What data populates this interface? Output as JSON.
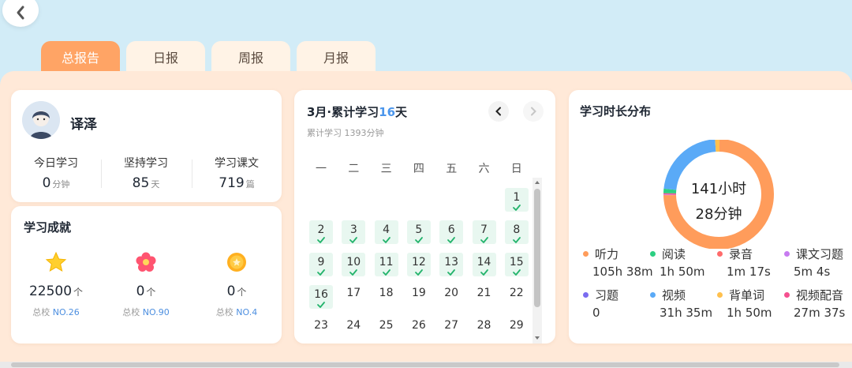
{
  "tabs": [
    "总报告",
    "日报",
    "周报",
    "月报"
  ],
  "profile": {
    "name": "译泽",
    "stats": [
      {
        "label": "今日学习",
        "value": "0",
        "unit": "分钟"
      },
      {
        "label": "坚持学习",
        "value": "85",
        "unit": "天"
      },
      {
        "label": "学习课文",
        "value": "719",
        "unit": "篇"
      }
    ]
  },
  "achievements": {
    "title": "学习成就",
    "items": [
      {
        "icon": "star-icon",
        "value": "22500",
        "unit": "个",
        "rank_prefix": "总校",
        "rank": "NO.26"
      },
      {
        "icon": "flower-icon",
        "value": "0",
        "unit": "个",
        "rank_prefix": "总校",
        "rank": "NO.90"
      },
      {
        "icon": "medal-icon",
        "value": "0",
        "unit": "个",
        "rank_prefix": "总校",
        "rank": "NO.4"
      }
    ]
  },
  "calendar": {
    "title_prefix": "3月·累计学习",
    "title_days": "16",
    "title_suffix": "天",
    "subtitle": "累计学习 1393分钟",
    "weekdays": [
      "一",
      "二",
      "三",
      "四",
      "五",
      "六",
      "日"
    ],
    "days": [
      {
        "d": "1",
        "done": true,
        "col": 6,
        "row": 0
      },
      {
        "d": "2",
        "done": true,
        "col": 0,
        "row": 1
      },
      {
        "d": "3",
        "done": true,
        "col": 1,
        "row": 1
      },
      {
        "d": "4",
        "done": true,
        "col": 2,
        "row": 1
      },
      {
        "d": "5",
        "done": true,
        "col": 3,
        "row": 1
      },
      {
        "d": "6",
        "done": true,
        "col": 4,
        "row": 1
      },
      {
        "d": "7",
        "done": true,
        "col": 5,
        "row": 1
      },
      {
        "d": "8",
        "done": true,
        "col": 6,
        "row": 1
      },
      {
        "d": "9",
        "done": true,
        "col": 0,
        "row": 2
      },
      {
        "d": "10",
        "done": true,
        "col": 1,
        "row": 2
      },
      {
        "d": "11",
        "done": true,
        "col": 2,
        "row": 2
      },
      {
        "d": "12",
        "done": true,
        "col": 3,
        "row": 2
      },
      {
        "d": "13",
        "done": true,
        "col": 4,
        "row": 2
      },
      {
        "d": "14",
        "done": true,
        "col": 5,
        "row": 2
      },
      {
        "d": "15",
        "done": true,
        "col": 6,
        "row": 2
      },
      {
        "d": "16",
        "done": true,
        "col": 0,
        "row": 3
      },
      {
        "d": "17",
        "done": false,
        "col": 1,
        "row": 3
      },
      {
        "d": "18",
        "done": false,
        "col": 2,
        "row": 3
      },
      {
        "d": "19",
        "done": false,
        "col": 3,
        "row": 3
      },
      {
        "d": "20",
        "done": false,
        "col": 4,
        "row": 3
      },
      {
        "d": "21",
        "done": false,
        "col": 5,
        "row": 3
      },
      {
        "d": "22",
        "done": false,
        "col": 6,
        "row": 3
      },
      {
        "d": "23",
        "done": false,
        "col": 0,
        "row": 4
      },
      {
        "d": "24",
        "done": false,
        "col": 1,
        "row": 4
      },
      {
        "d": "25",
        "done": false,
        "col": 2,
        "row": 4
      },
      {
        "d": "26",
        "done": false,
        "col": 3,
        "row": 4
      },
      {
        "d": "27",
        "done": false,
        "col": 4,
        "row": 4
      },
      {
        "d": "28",
        "done": false,
        "col": 5,
        "row": 4
      },
      {
        "d": "29",
        "done": false,
        "col": 6,
        "row": 4
      }
    ]
  },
  "distribution": {
    "title": "学习时长分布",
    "total_line1": "141小时",
    "total_line2": "28分钟",
    "legend": [
      {
        "name": "听力",
        "value": "105h 38m",
        "color": "#ff9c5b"
      },
      {
        "name": "阅读",
        "value": "1h 50m",
        "color": "#2ccf82"
      },
      {
        "name": "录音",
        "value": "1m 17s",
        "color": "#ff6b6b"
      },
      {
        "name": "课文习题",
        "value": "5m 4s",
        "color": "#c77bf0"
      },
      {
        "name": "习题",
        "value": "0",
        "color": "#7a6cf0"
      },
      {
        "name": "视频",
        "value": "31h 35m",
        "color": "#5aaaf7"
      },
      {
        "name": "背单词",
        "value": "1h 50m",
        "color": "#ffc04d"
      },
      {
        "name": "视频配音",
        "value": "27m 37s",
        "color": "#f5508f"
      }
    ]
  },
  "chart_data": {
    "type": "pie",
    "categories": [
      "听力",
      "阅读",
      "录音",
      "课文习题",
      "习题",
      "视频",
      "背单词",
      "视频配音"
    ],
    "values_minutes": [
      6338,
      110,
      1.28,
      5.07,
      0,
      1895,
      110,
      27.6
    ],
    "colors": [
      "#ff9c5b",
      "#2ccf82",
      "#ff6b6b",
      "#c77bf0",
      "#7a6cf0",
      "#5aaaf7",
      "#ffc04d",
      "#f5508f"
    ]
  }
}
